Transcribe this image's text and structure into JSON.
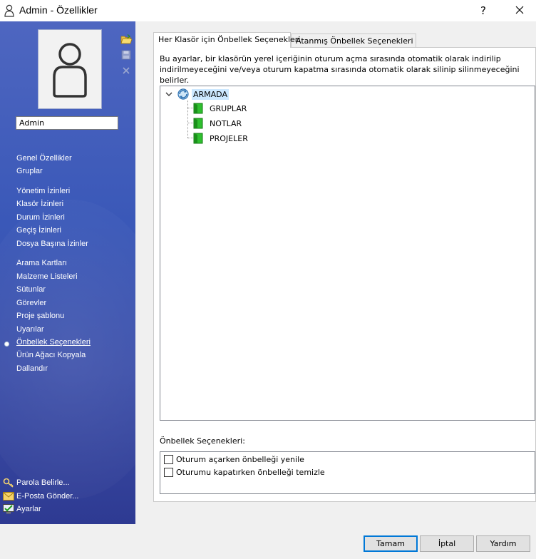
{
  "window": {
    "title": "Admin - Özellikler",
    "help_label": "?",
    "close_label": "✕"
  },
  "user": {
    "name": "Admin"
  },
  "sidebar": {
    "groups": [
      [
        "Genel Özellikler",
        "Gruplar"
      ],
      [
        "Yönetim İzinleri",
        "Klasör İzinleri",
        "Durum İzinleri",
        "Geçiş İzinleri",
        "Dosya Başına İzinler"
      ],
      [
        "Arama Kartları",
        "Malzeme Listeleri",
        "Sütunlar",
        "Görevler",
        "Proje şablonu",
        "Uyarılar",
        "Önbellek Seçenekleri",
        "Ürün Ağacı Kopyala",
        "Dallandır"
      ]
    ],
    "items": [
      {
        "label": "Genel Özellikler"
      },
      {
        "label": "Gruplar"
      },
      {
        "label": "Yönetim İzinleri"
      },
      {
        "label": "Klasör İzinleri"
      },
      {
        "label": "Durum İzinleri"
      },
      {
        "label": "Geçiş İzinleri"
      },
      {
        "label": "Dosya Başına İzinler"
      },
      {
        "label": "Arama Kartları"
      },
      {
        "label": "Malzeme Listeleri"
      },
      {
        "label": "Sütunlar"
      },
      {
        "label": "Görevler"
      },
      {
        "label": "Proje şablonu"
      },
      {
        "label": "Uyarılar"
      },
      {
        "label": "Önbellek Seçenekleri",
        "active": true
      },
      {
        "label": "Ürün Ağacı Kopyala"
      },
      {
        "label": "Dallandır"
      }
    ],
    "bottom": [
      {
        "label": "Parola Belirle...",
        "icon": "key-icon"
      },
      {
        "label": "E-Posta Gönder...",
        "icon": "envelope-icon"
      },
      {
        "label": "Ayarlar",
        "icon": "settings-monitor-icon"
      }
    ],
    "tools": [
      "open-folder-icon",
      "save-icon",
      "delete-icon"
    ]
  },
  "tabs": [
    {
      "label": "Her Klasör için Önbellek Seçenekleri",
      "active": true
    },
    {
      "label": "Atanmış Önbellek Seçenekleri",
      "active": false
    }
  ],
  "panel": {
    "description": "Bu ayarlar, bir klasörün yerel içeriğinin oturum açma sırasında otomatik olarak indirilip indirilmeyeceğini ve/veya oturum kapatma sırasında otomatik olarak silinip silinmeyeceğini belirler.",
    "tree": {
      "root": "ARMADA",
      "children": [
        "GRUPLAR",
        "NOTLAR",
        "PROJELER"
      ]
    },
    "options_label": "Önbellek Seçenekleri:",
    "options": [
      {
        "label": "Oturum açarken önbelleği yenile",
        "checked": false
      },
      {
        "label": "Oturumu kapatırken önbelleği temizle",
        "checked": false
      }
    ]
  },
  "buttons": {
    "ok": "Tamam",
    "cancel": "İptal",
    "help": "Yardım"
  },
  "colors": {
    "sidebar_top": "#4e66c0",
    "sidebar_bottom": "#2e3a92",
    "folder_green": "#22aa22",
    "selection": "#cce8ff",
    "default_button_border": "#0078d7"
  }
}
